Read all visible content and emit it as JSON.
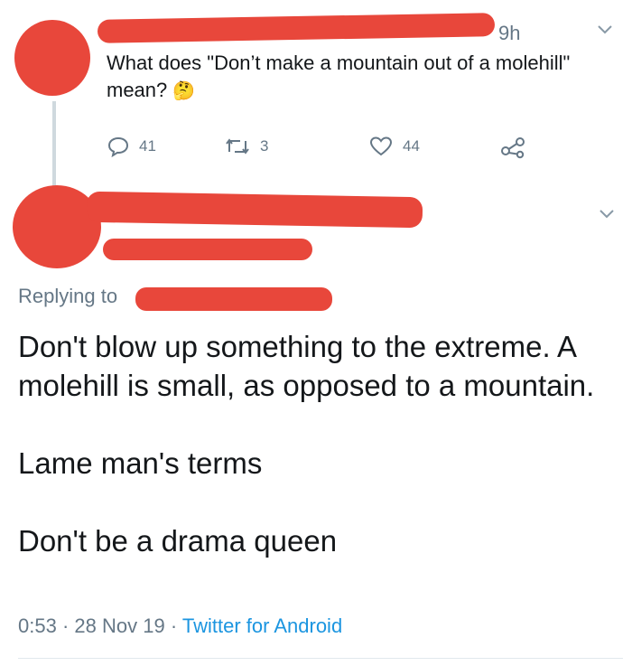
{
  "tweet": {
    "time": "9h",
    "text": "What does \"Don’t make a mountain out of a molehill\" mean?",
    "emoji": "🤔",
    "replies": "41",
    "retweets": "3",
    "likes": "44"
  },
  "reply": {
    "replying_label": "Replying to",
    "lines": [
      "Don't blow up something to the extreme. A molehill is small, as opposed to a mountain.",
      "Lame man's terms",
      "Don't be a drama queen"
    ],
    "time": "0:53",
    "date": "28 Nov 19",
    "separator": "·",
    "source": "Twitter for Android"
  },
  "colors": {
    "redaction": "#e8473b",
    "link": "#1b95e0",
    "muted": "#657786"
  }
}
